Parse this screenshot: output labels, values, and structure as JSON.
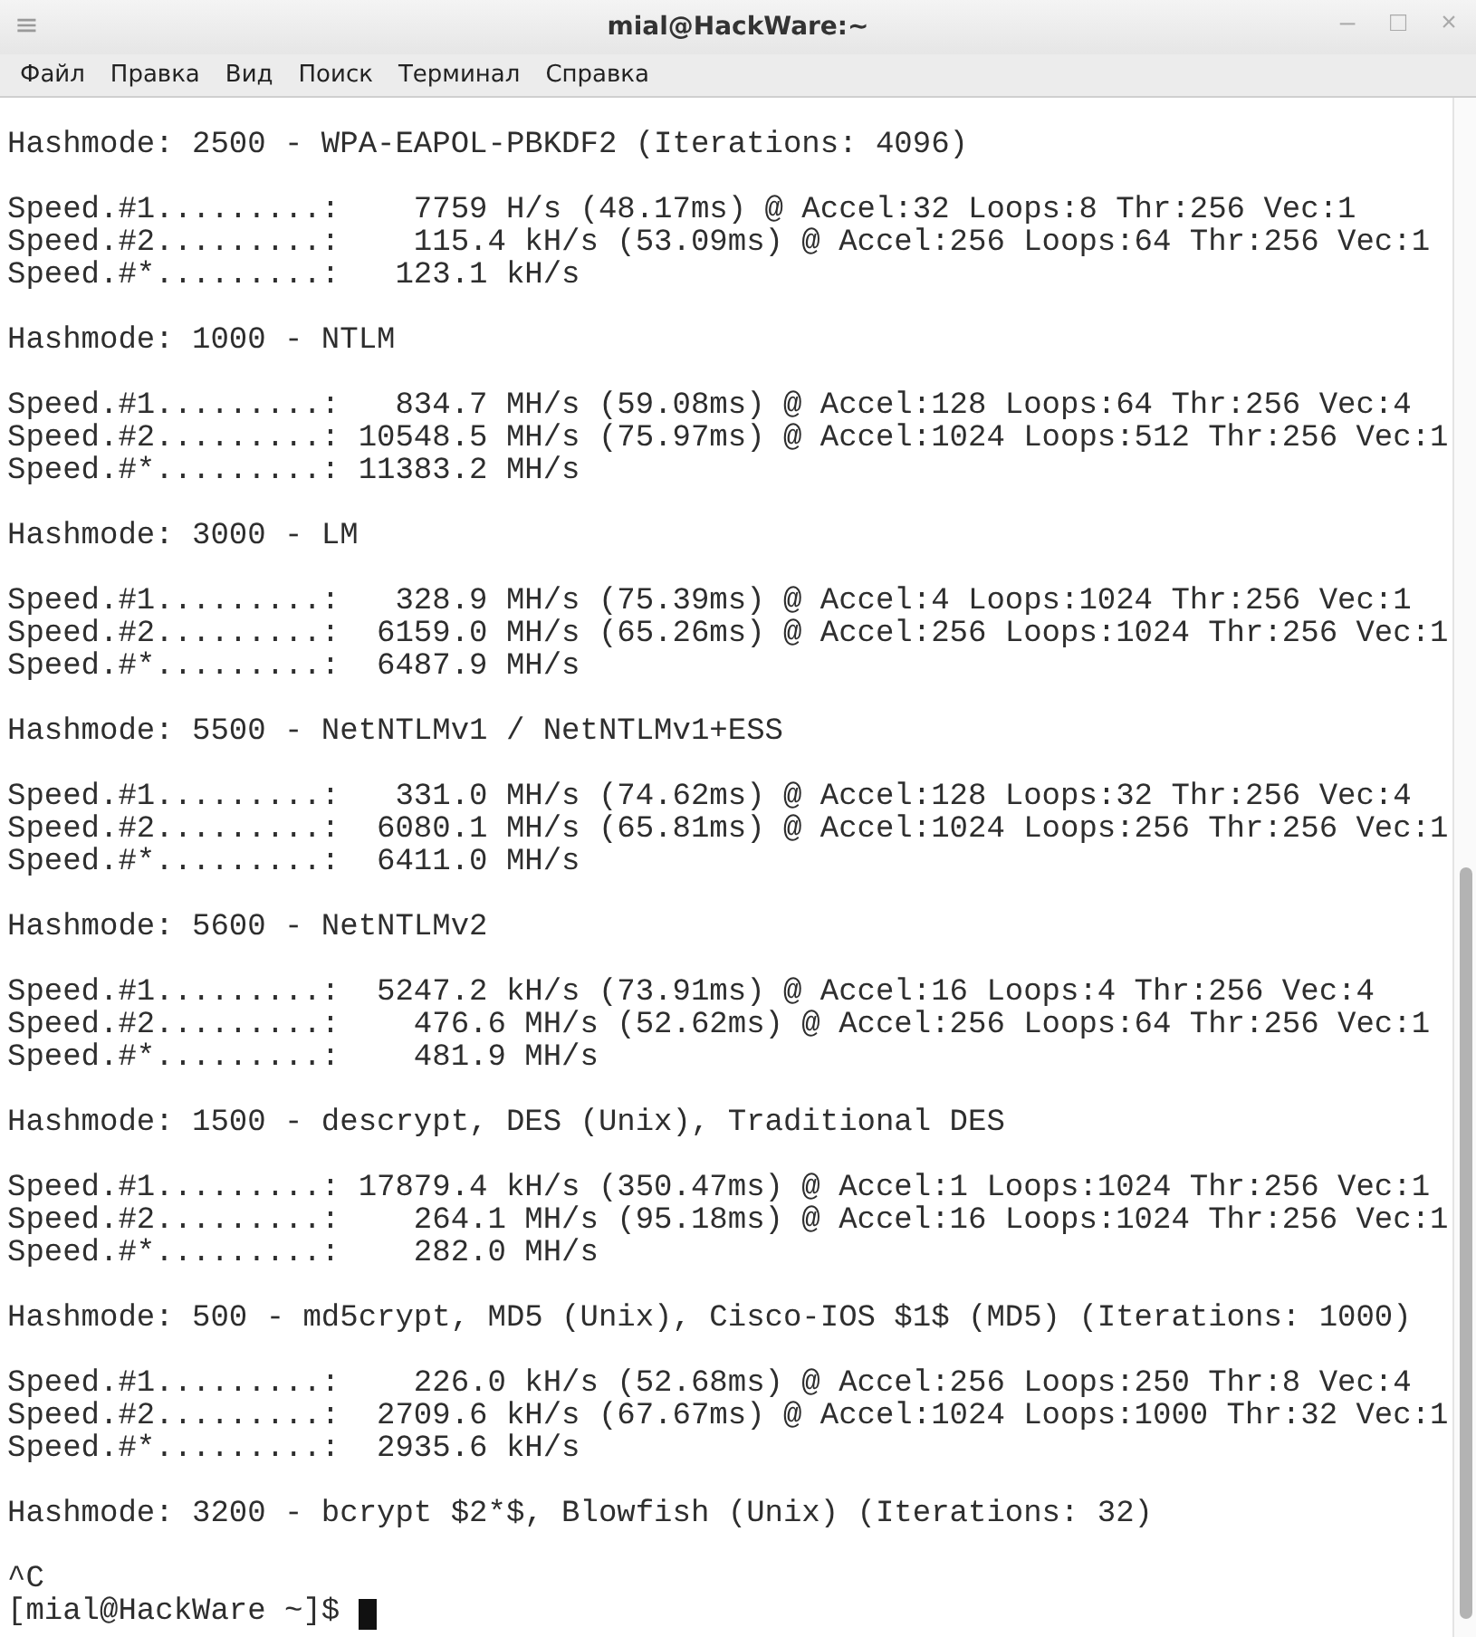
{
  "window": {
    "title": "mial@HackWare:~",
    "menu_icon": "≡",
    "controls": [
      "–",
      "□",
      "×"
    ]
  },
  "menu": [
    "Файл",
    "Правка",
    "Вид",
    "Поиск",
    "Терминал",
    "Справка"
  ],
  "terminal": {
    "groups": [
      {
        "lines": [
          "Hashmode: 2500 - WPA-EAPOL-PBKDF2 (Iterations: 4096)"
        ]
      },
      {
        "lines": [
          "Speed.#1.........:    7759 H/s (48.17ms) @ Accel:32 Loops:8 Thr:256 Vec:1",
          "Speed.#2.........:    115.4 kH/s (53.09ms) @ Accel:256 Loops:64 Thr:256 Vec:1",
          "Speed.#*.........:   123.1 kH/s"
        ]
      },
      {
        "lines": [
          "Hashmode: 1000 - NTLM"
        ]
      },
      {
        "lines": [
          "Speed.#1.........:   834.7 MH/s (59.08ms) @ Accel:128 Loops:64 Thr:256 Vec:4",
          "Speed.#2.........: 10548.5 MH/s (75.97ms) @ Accel:1024 Loops:512 Thr:256 Vec:1",
          "Speed.#*.........: 11383.2 MH/s"
        ]
      },
      {
        "lines": [
          "Hashmode: 3000 - LM"
        ]
      },
      {
        "lines": [
          "Speed.#1.........:   328.9 MH/s (75.39ms) @ Accel:4 Loops:1024 Thr:256 Vec:1",
          "Speed.#2.........:  6159.0 MH/s (65.26ms) @ Accel:256 Loops:1024 Thr:256 Vec:1",
          "Speed.#*.........:  6487.9 MH/s"
        ]
      },
      {
        "lines": [
          "Hashmode: 5500 - NetNTLMv1 / NetNTLMv1+ESS"
        ]
      },
      {
        "lines": [
          "Speed.#1.........:   331.0 MH/s (74.62ms) @ Accel:128 Loops:32 Thr:256 Vec:4",
          "Speed.#2.........:  6080.1 MH/s (65.81ms) @ Accel:1024 Loops:256 Thr:256 Vec:1",
          "Speed.#*.........:  6411.0 MH/s"
        ]
      },
      {
        "lines": [
          "Hashmode: 5600 - NetNTLMv2"
        ]
      },
      {
        "lines": [
          "Speed.#1.........:  5247.2 kH/s (73.91ms) @ Accel:16 Loops:4 Thr:256 Vec:4",
          "Speed.#2.........:    476.6 MH/s (52.62ms) @ Accel:256 Loops:64 Thr:256 Vec:1",
          "Speed.#*.........:    481.9 MH/s"
        ]
      },
      {
        "lines": [
          "Hashmode: 1500 - descrypt, DES (Unix), Traditional DES"
        ]
      },
      {
        "lines": [
          "Speed.#1.........: 17879.4 kH/s (350.47ms) @ Accel:1 Loops:1024 Thr:256 Vec:1",
          "Speed.#2.........:    264.1 MH/s (95.18ms) @ Accel:16 Loops:1024 Thr:256 Vec:1",
          "Speed.#*.........:    282.0 MH/s"
        ]
      },
      {
        "lines": [
          "Hashmode: 500 - md5crypt, MD5 (Unix), Cisco-IOS $1$ (MD5) (Iterations: 1000)"
        ]
      },
      {
        "lines": [
          "Speed.#1.........:    226.0 kH/s (52.68ms) @ Accel:256 Loops:250 Thr:8 Vec:4",
          "Speed.#2.........:  2709.6 kH/s (67.67ms) @ Accel:1024 Loops:1000 Thr:32 Vec:1",
          "Speed.#*.........:  2935.6 kH/s"
        ]
      },
      {
        "lines": [
          "Hashmode: 3200 - bcrypt $2*$, Blowfish (Unix) (Iterations: 32)"
        ]
      },
      {
        "lines": [
          "^C"
        ]
      }
    ],
    "prompt": "[mial@HackWare ~]$"
  }
}
